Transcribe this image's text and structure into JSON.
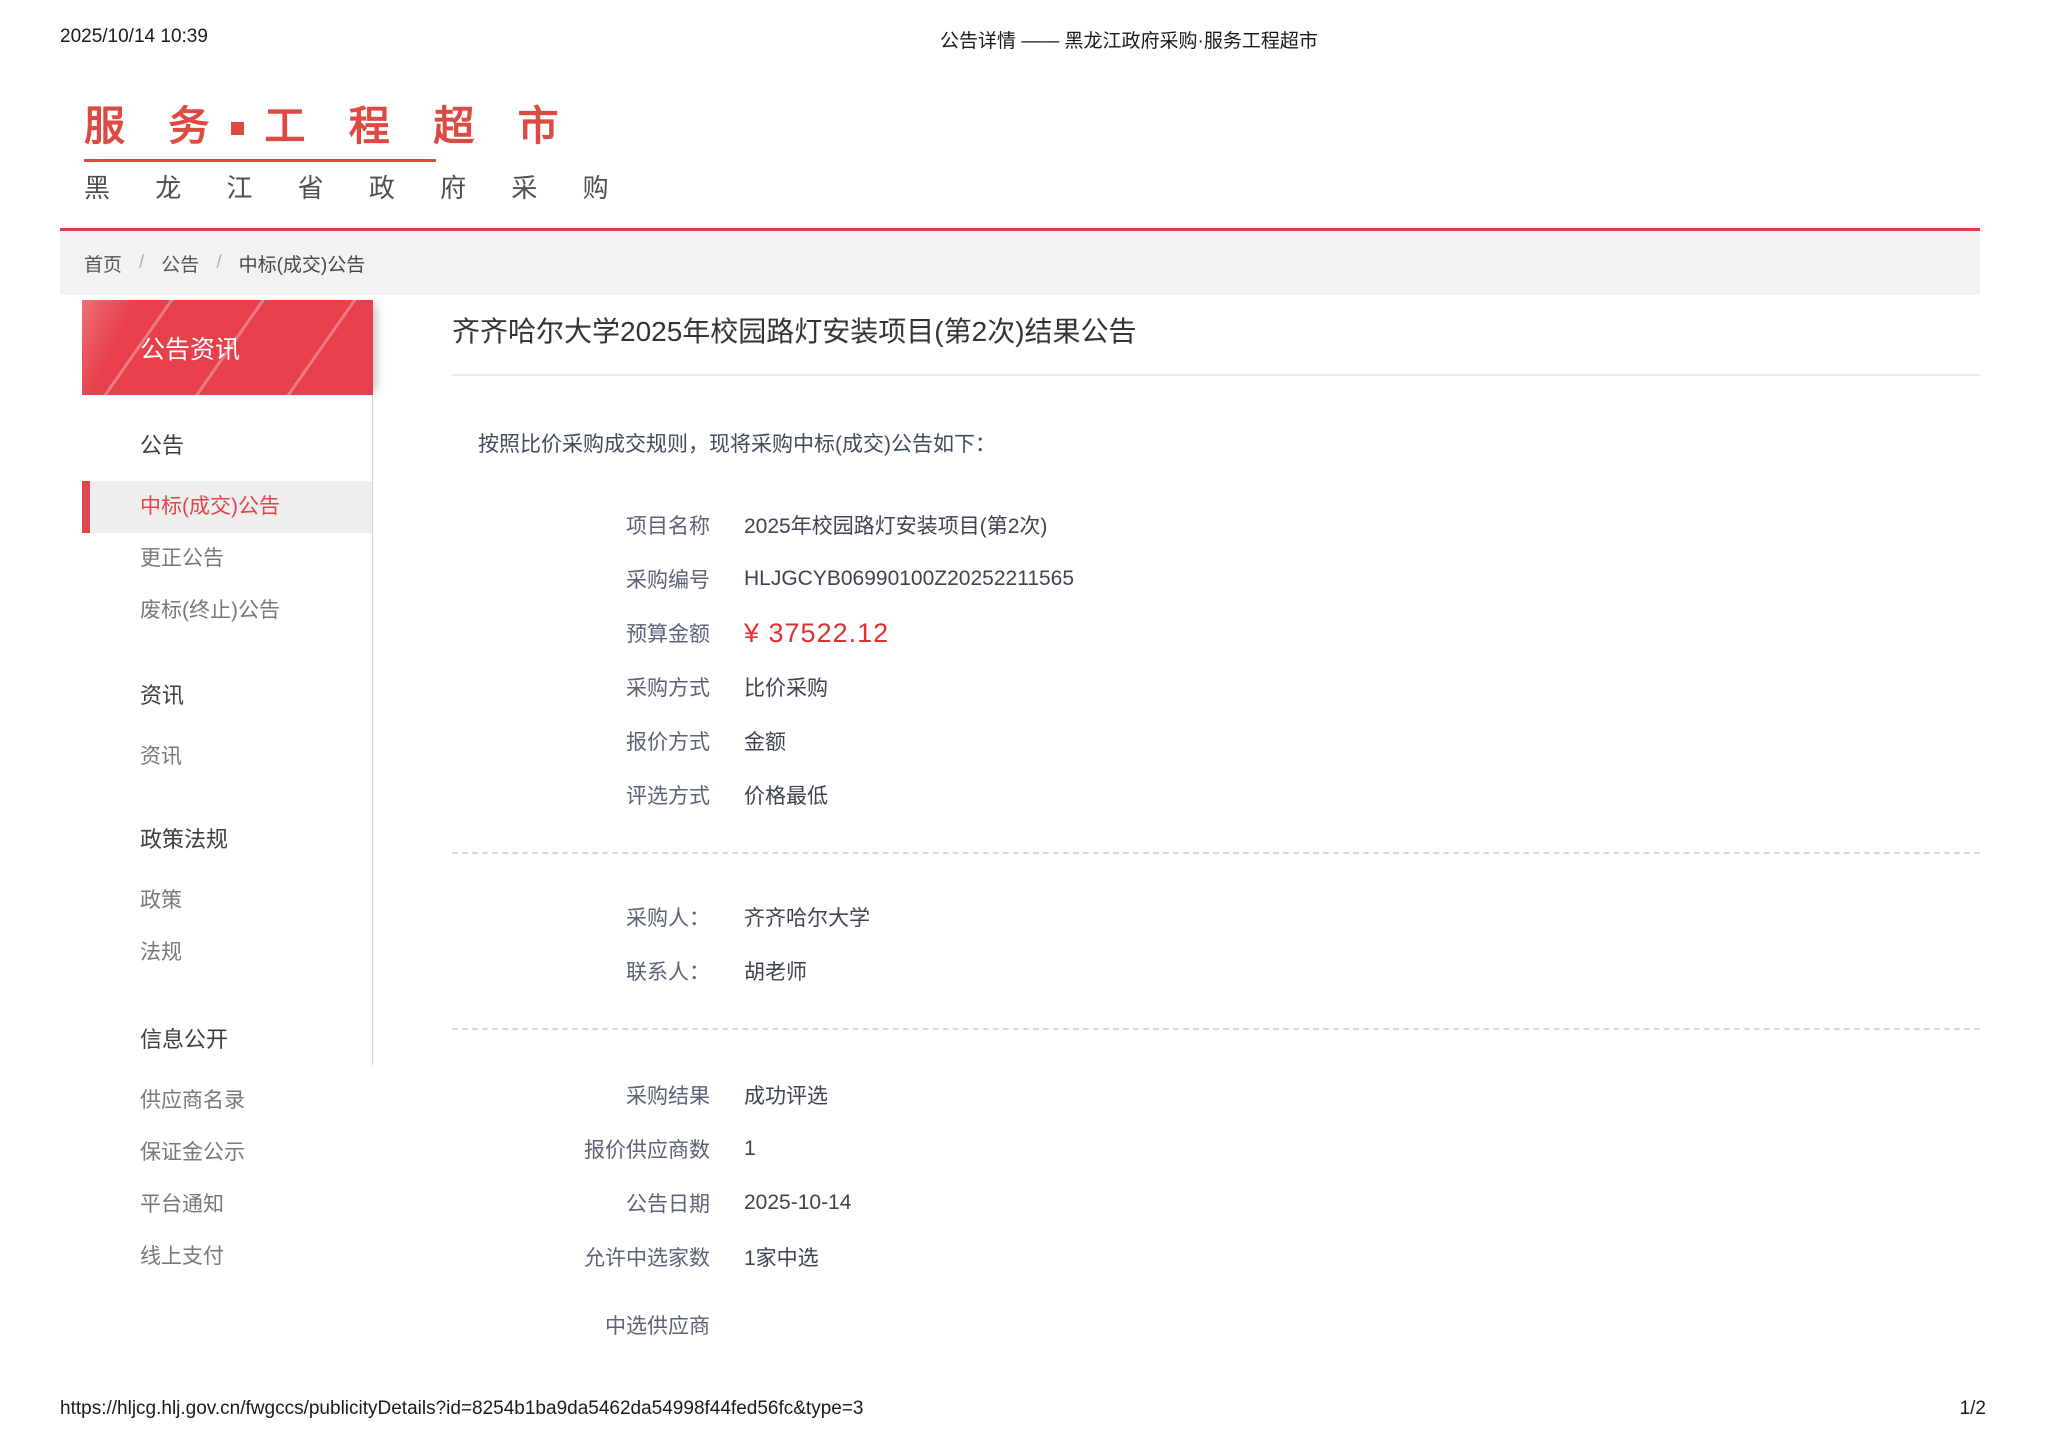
{
  "print_header": {
    "timestamp": "2025/10/14 10:39",
    "title": "公告详情 —— 黑龙江政府采购·服务工程超市"
  },
  "logo": {
    "title_left": "服 务",
    "title_right": "工 程 超 市",
    "subtitle": "黑 龙 江 省 政 府 采 购"
  },
  "breadcrumb": {
    "separator": "/",
    "items": [
      "首页",
      "公告",
      "中标(成交)公告"
    ]
  },
  "sidebar": {
    "header": "公告资讯",
    "sections": [
      {
        "title": "公告",
        "items": [
          {
            "label": "中标(成交)公告",
            "active": true
          },
          {
            "label": "更正公告",
            "active": false
          },
          {
            "label": "废标(终止)公告",
            "active": false
          }
        ]
      },
      {
        "title": "资讯",
        "items": [
          {
            "label": "资讯",
            "active": false
          }
        ]
      },
      {
        "title": "政策法规",
        "items": [
          {
            "label": "政策",
            "active": false
          },
          {
            "label": "法规",
            "active": false
          }
        ]
      },
      {
        "title": "信息公开",
        "items": [
          {
            "label": "供应商名录",
            "active": false
          },
          {
            "label": "保证金公示",
            "active": false
          },
          {
            "label": "平台通知",
            "active": false
          },
          {
            "label": "线上支付",
            "active": false
          }
        ]
      }
    ]
  },
  "main": {
    "title": "齐齐哈尔大学2025年校园路灯安装项目(第2次)结果公告",
    "intro": "按照比价采购成交规则，现将采购中标(成交)公告如下：",
    "groups": [
      {
        "rows": [
          {
            "label": "项目名称",
            "value": "2025年校园路灯安装项目(第2次)",
            "emphasis": false
          },
          {
            "label": "采购编号",
            "value": "HLJGCYB06990100Z20252211565",
            "emphasis": false
          },
          {
            "label": "预算金额",
            "value": "¥ 37522.12",
            "emphasis": true
          },
          {
            "label": "采购方式",
            "value": "比价采购",
            "emphasis": false
          },
          {
            "label": "报价方式",
            "value": "金额",
            "emphasis": false
          },
          {
            "label": "评选方式",
            "value": "价格最低",
            "emphasis": false
          }
        ]
      },
      {
        "rows": [
          {
            "label": "采购人：",
            "value": "齐齐哈尔大学",
            "emphasis": false
          },
          {
            "label": "联系人：",
            "value": "胡老师",
            "emphasis": false
          }
        ]
      },
      {
        "rows": [
          {
            "label": "采购结果",
            "value": "成功评选",
            "emphasis": false
          },
          {
            "label": "报价供应商数",
            "value": "1",
            "emphasis": false
          },
          {
            "label": "公告日期",
            "value": "2025-10-14",
            "emphasis": false
          },
          {
            "label": "允许中选家数",
            "value": "1家中选",
            "emphasis": false
          },
          {
            "label": "中选供应商",
            "value": "",
            "emphasis": false,
            "gap_before": true
          }
        ]
      }
    ]
  },
  "print_footer": {
    "url": "https://hljcg.hlj.gov.cn/fwgccs/publicityDetails?id=8254b1ba9da5462da54998f44fed56fc&type=3",
    "page": "1/2"
  },
  "colors": {
    "logo_red": "#dc4a42",
    "accent_red": "#e8404a",
    "active_red": "#e0454d",
    "budget_red": "#e42f2f"
  }
}
